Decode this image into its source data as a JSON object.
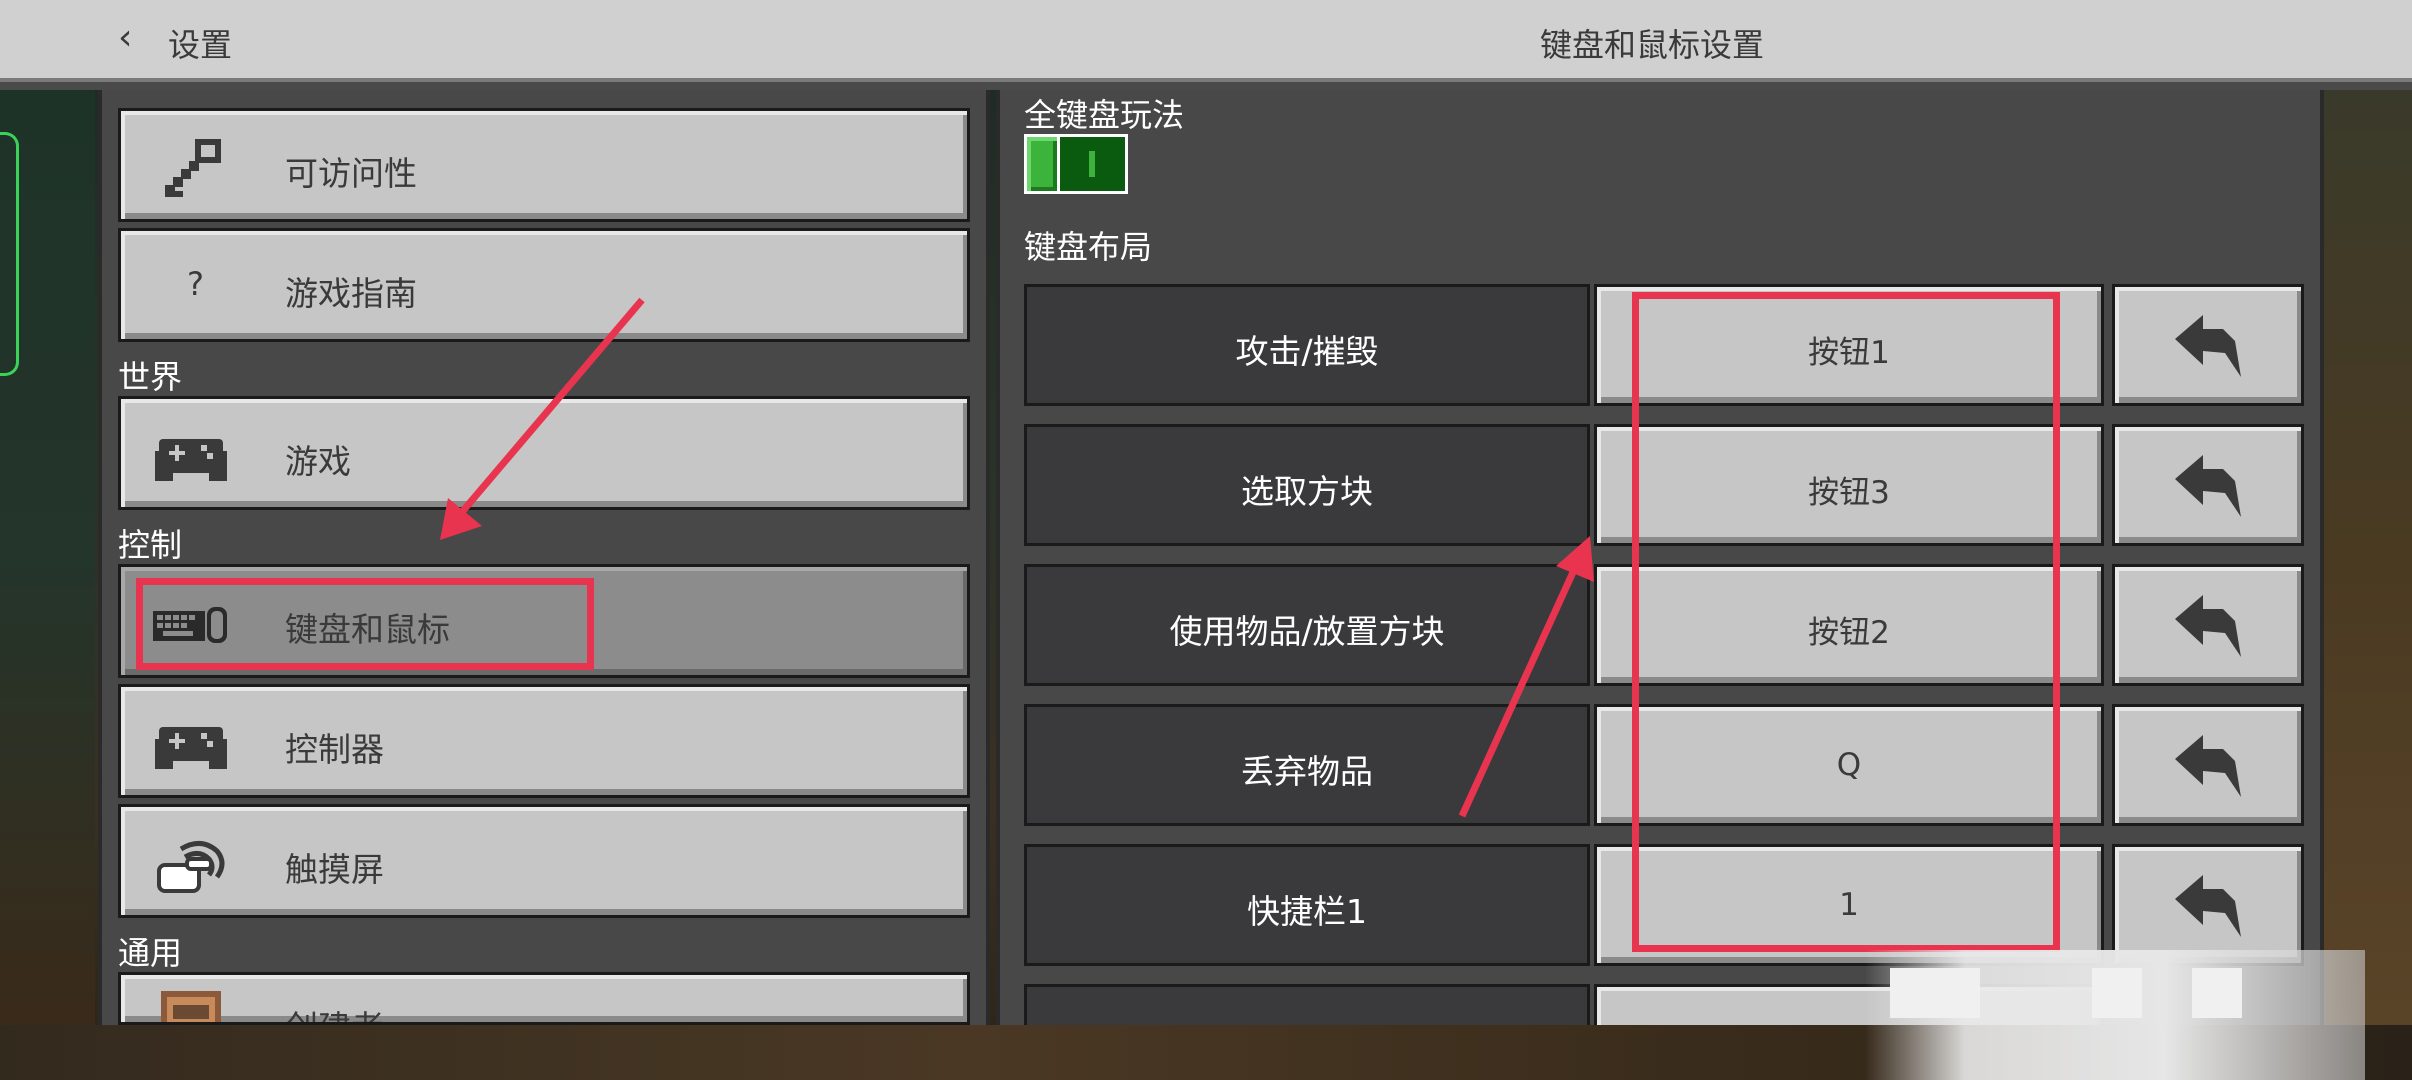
{
  "header": {
    "back_label": "设置",
    "title": "键盘和鼠标设置"
  },
  "sidebar": {
    "items": [
      {
        "label": "可访问性",
        "icon": "key-icon"
      },
      {
        "label": "游戏指南",
        "icon": "question-icon",
        "glyph": "?"
      },
      {
        "label": "游戏",
        "icon": "gamepad-icon"
      },
      {
        "label": "键盘和鼠标",
        "icon": "keyboard-mouse-icon",
        "selected": true
      },
      {
        "label": "控制器",
        "icon": "gamepad-icon"
      },
      {
        "label": "触摸屏",
        "icon": "touch-icon"
      },
      {
        "label": "创建者",
        "icon": "creator-icon"
      }
    ],
    "sections": {
      "world": "世界",
      "controls": "控制",
      "general": "通用"
    }
  },
  "settings": {
    "full_keyboard_label": "全键盘玩法",
    "full_keyboard_enabled": true,
    "layout_label": "键盘布局",
    "bindings": [
      {
        "action": "攻击/摧毁",
        "key": "按钮1"
      },
      {
        "action": "选取方块",
        "key": "按钮3"
      },
      {
        "action": "使用物品/放置方块",
        "key": "按钮2"
      },
      {
        "action": "丢弃物品",
        "key": "Q"
      },
      {
        "action": "快捷栏1",
        "key": "1"
      },
      {
        "action": "",
        "key": ""
      }
    ]
  },
  "colors": {
    "annotation": "#e8344e",
    "toggle_on": "#3cb43c",
    "panel_bg": "#484848",
    "button_bg": "#c6c6c6"
  }
}
